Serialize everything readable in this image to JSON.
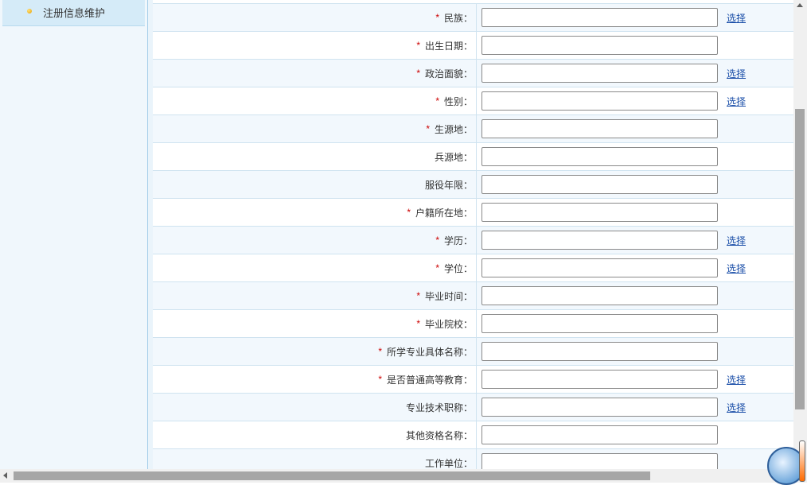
{
  "sidebar": {
    "items": [
      {
        "label": "注册信息维护"
      }
    ]
  },
  "form": {
    "choose_label": "选择",
    "rows": [
      {
        "label": "民族：",
        "required": true,
        "value": "",
        "has_choose": true
      },
      {
        "label": "出生日期：",
        "required": true,
        "value": "",
        "has_choose": false
      },
      {
        "label": "政治面貌：",
        "required": true,
        "value": "",
        "has_choose": true
      },
      {
        "label": "性别：",
        "required": true,
        "value": "",
        "has_choose": true
      },
      {
        "label": "生源地：",
        "required": true,
        "value": "",
        "has_choose": false
      },
      {
        "label": "兵源地：",
        "required": false,
        "value": "",
        "has_choose": false
      },
      {
        "label": "服役年限：",
        "required": false,
        "value": "",
        "has_choose": false
      },
      {
        "label": "户籍所在地：",
        "required": true,
        "value": "",
        "has_choose": false
      },
      {
        "label": "学历：",
        "required": true,
        "value": "",
        "has_choose": true
      },
      {
        "label": "学位：",
        "required": true,
        "value": "",
        "has_choose": true
      },
      {
        "label": "毕业时间：",
        "required": true,
        "value": "",
        "has_choose": false
      },
      {
        "label": "毕业院校：",
        "required": true,
        "value": "",
        "has_choose": false
      },
      {
        "label": "所学专业具体名称：",
        "required": true,
        "value": "",
        "has_choose": false
      },
      {
        "label": "是否普通高等教育：",
        "required": true,
        "value": "",
        "has_choose": true
      },
      {
        "label": "专业技术职称：",
        "required": false,
        "value": "",
        "has_choose": true
      },
      {
        "label": "其他资格名称：",
        "required": false,
        "value": "",
        "has_choose": false
      },
      {
        "label": "工作单位：",
        "required": false,
        "value": "",
        "has_choose": false
      }
    ]
  },
  "required_mark": "*",
  "colors": {
    "required": "#cc0000",
    "link": "#1a4ea8",
    "row_alt": "#f2f8fd",
    "sidebar_active": "#d5ebf8"
  },
  "icons": {
    "sidebar_bullet": "bullet-icon",
    "widget": "weather-widget-icon"
  }
}
